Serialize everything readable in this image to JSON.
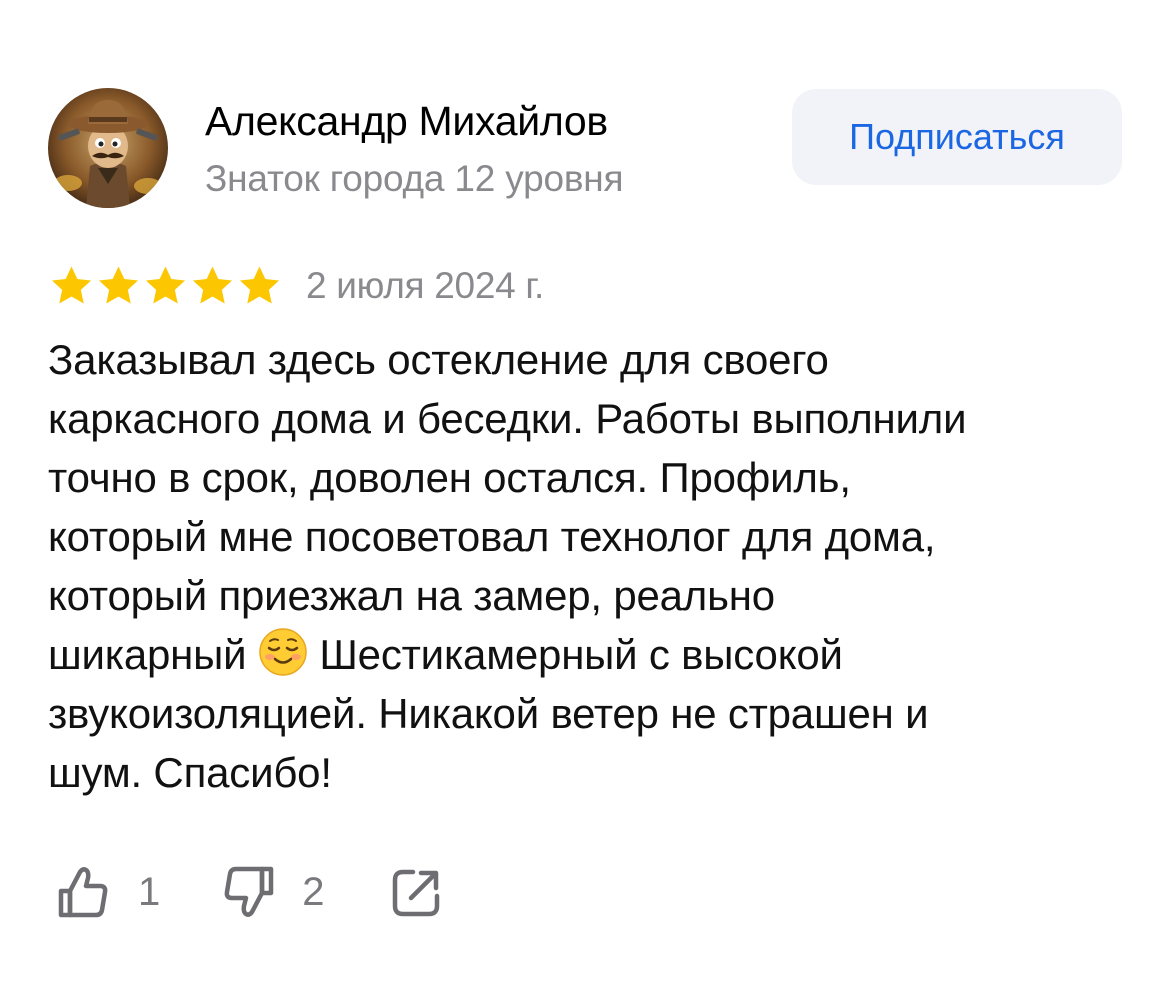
{
  "author": {
    "name": "Александр Михайлов",
    "level": "Знаток города 12 уровня",
    "avatar_icon": "avatar-image"
  },
  "subscribe_button": {
    "label": "Подписаться"
  },
  "review": {
    "rating": 5,
    "rating_max": 5,
    "date": "2 июля 2024 г.",
    "text_lines": [
      "Заказывал здесь остекление для своего",
      "каркасного дома и беседки. Работы выполнили",
      "точно в срок,  доволен остался. Профиль,",
      "который мне посоветовал технолог для дома,",
      "который приезжал на замер, реально"
    ],
    "text_line_6_before_emoji": "шикарный",
    "emoji": "☺️",
    "text_line_6_after_emoji": "Шестикамерный с высокой",
    "text_lines_end": [
      "звукоизоляцией. Никакой ветер не страшен и",
      "шум. Спасибо!"
    ]
  },
  "actions": {
    "likes": "1",
    "dislikes": "2",
    "like_icon": "thumbs-up-icon",
    "dislike_icon": "thumbs-down-icon",
    "share_icon": "share-icon"
  },
  "colors": {
    "accent": "#1b66e3",
    "star": "#fcc700",
    "muted": "#8a8a8e",
    "button_bg": "#f2f3f8"
  }
}
